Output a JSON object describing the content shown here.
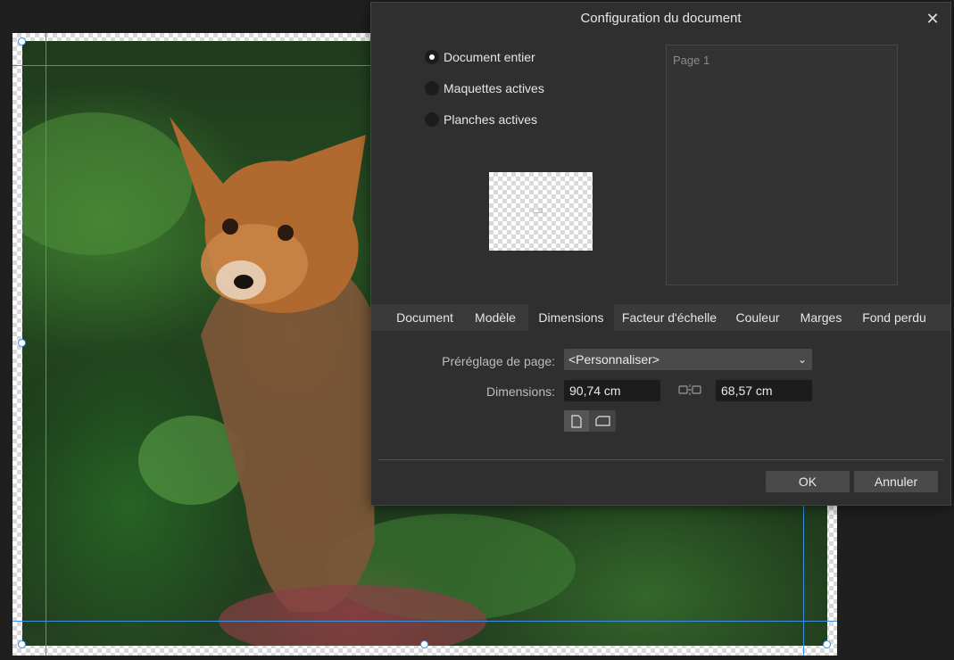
{
  "dialog": {
    "title": "Configuration du document",
    "close_icon": "close-icon"
  },
  "scope_options": [
    {
      "label": "Document entier",
      "checked": true
    },
    {
      "label": "Maquettes actives",
      "checked": false
    },
    {
      "label": "Planches actives",
      "checked": false
    }
  ],
  "page_list": {
    "items": [
      "Page 1"
    ]
  },
  "tabs": [
    {
      "label": "Document",
      "active": false
    },
    {
      "label": "Modèle",
      "active": false
    },
    {
      "label": "Dimensions",
      "active": true
    },
    {
      "label": "Facteur d'échelle",
      "active": false
    },
    {
      "label": "Couleur",
      "active": false
    },
    {
      "label": "Marges",
      "active": false
    },
    {
      "label": "Fond perdu",
      "active": false
    }
  ],
  "dimensions_tab": {
    "preset_label": "Préréglage de page:",
    "preset_value": "<Personnaliser>",
    "dimensions_label": "Dimensions:",
    "width_value": "90,74 cm",
    "height_value": "68,57 cm",
    "link_icon": "link-icon",
    "orientation": {
      "portrait_icon": "portrait-icon",
      "landscape_icon": "landscape-icon"
    }
  },
  "buttons": {
    "ok": "OK",
    "cancel": "Annuler"
  },
  "colors": {
    "guide": "#3a8ee6",
    "dialog_bg": "#2f2f2f",
    "tab_bar": "#3a3a3a"
  }
}
